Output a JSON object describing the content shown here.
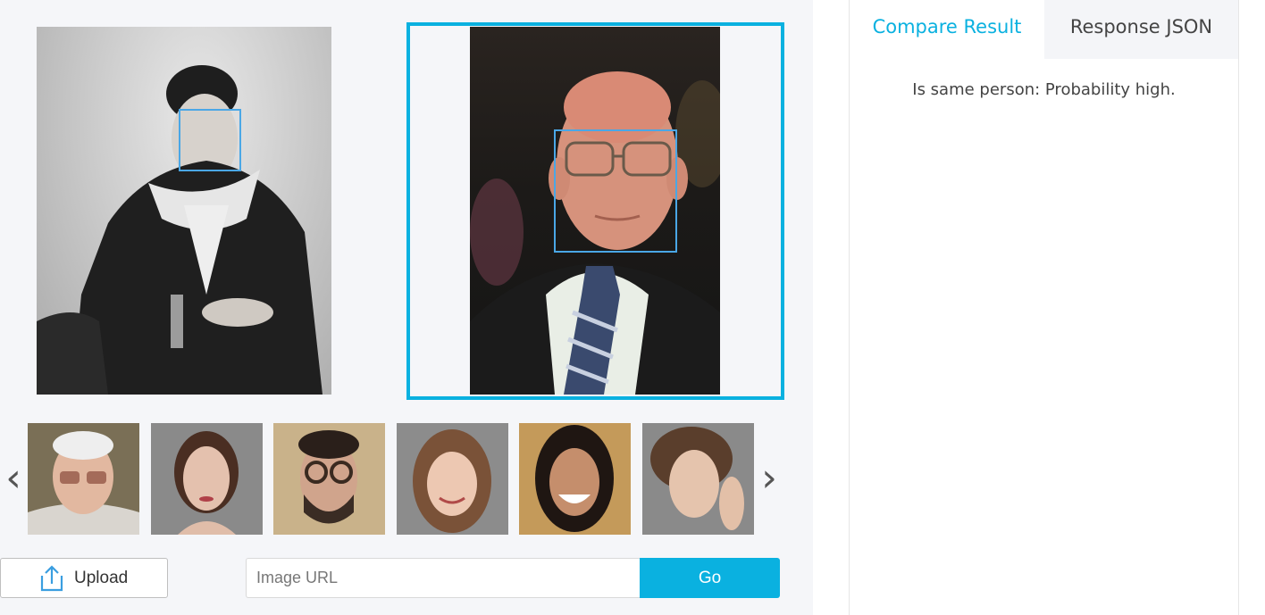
{
  "tabs": {
    "compare_label": "Compare Result",
    "json_label": "Response JSON"
  },
  "result": {
    "text": "Is same person: Probability high."
  },
  "controls": {
    "upload_label": "Upload",
    "url_placeholder": "Image URL",
    "go_label": "Go"
  },
  "nav": {
    "prev_glyph": "‹",
    "next_glyph": "›"
  },
  "colors": {
    "accent": "#0ab1e0",
    "face_box": "#4aa7e6",
    "tab_inactive_bg": "#f4f5f8"
  },
  "icons": {
    "upload": "upload-icon",
    "prev": "chevron-left-icon",
    "next": "chevron-right-icon"
  }
}
